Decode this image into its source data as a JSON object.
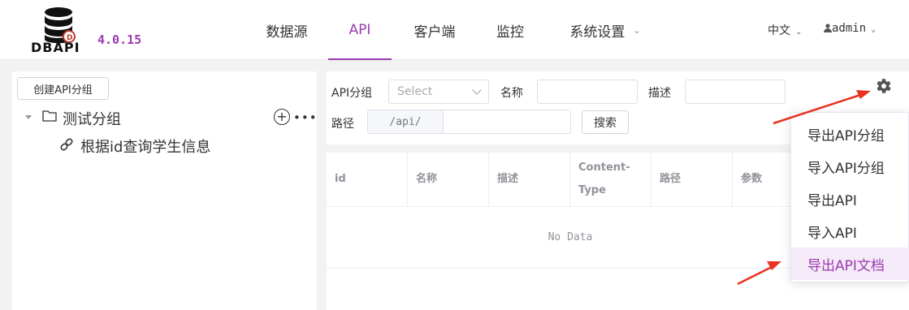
{
  "header": {
    "logo_text": "DBAPI",
    "version": "4.0.15",
    "nav": [
      {
        "label": "数据源"
      },
      {
        "label": "API"
      },
      {
        "label": "客户端"
      },
      {
        "label": "监控"
      },
      {
        "label": "系统设置"
      }
    ],
    "language": "中文",
    "user": "admin"
  },
  "sidebar": {
    "create_group_label": "创建API分组",
    "group_name": "测试分组",
    "more": "•••",
    "api_item": "根据id查询学生信息"
  },
  "search": {
    "group_label": "API分组",
    "group_placeholder": "Select",
    "name_label": "名称",
    "desc_label": "描述",
    "path_label": "路径",
    "path_prefix": "/api/",
    "search_button": "搜索"
  },
  "table": {
    "columns": [
      "id",
      "名称",
      "描述",
      "Content-Type",
      "路径",
      "参数"
    ],
    "empty_text": "No Data"
  },
  "dropdown": {
    "items": [
      "导出API分组",
      "导入API分组",
      "导出API",
      "导入API",
      "导出API文档"
    ]
  },
  "colors": {
    "accent": "#9b3bb0",
    "annotation_arrow": "#e8321f"
  }
}
